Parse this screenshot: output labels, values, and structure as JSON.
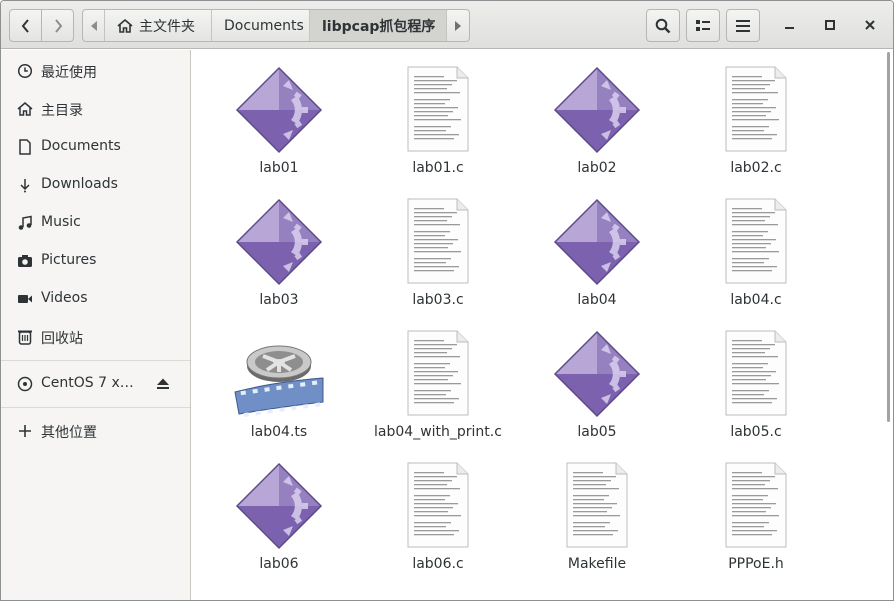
{
  "header": {
    "back_icon": "chevron-left",
    "forward_icon": "chevron-right",
    "path": [
      {
        "label": "主文件夹",
        "icon": "home-icon"
      },
      {
        "label": "Documents"
      },
      {
        "label": "libpcap抓包程序",
        "active": true
      }
    ],
    "search_icon": "search",
    "view_icon": "list-view",
    "menu_icon": "hamburger-menu",
    "window_controls": [
      "minimize",
      "maximize",
      "close"
    ]
  },
  "sidebar": {
    "items": [
      {
        "label": "最近使用",
        "icon": "clock-icon"
      },
      {
        "label": "主目录",
        "icon": "home-icon"
      },
      {
        "label": "Documents",
        "icon": "document-icon"
      },
      {
        "label": "Downloads",
        "icon": "download-icon"
      },
      {
        "label": "Music",
        "icon": "music-icon"
      },
      {
        "label": "Pictures",
        "icon": "camera-icon"
      },
      {
        "label": "Videos",
        "icon": "video-icon"
      },
      {
        "label": "回收站",
        "icon": "trash-icon"
      }
    ],
    "devices": [
      {
        "label": "CentOS 7 x…",
        "icon": "disc-icon",
        "action_icon": "eject-icon"
      }
    ],
    "other": {
      "label": "其他位置",
      "icon": "plus-icon"
    }
  },
  "files": [
    {
      "name": "lab01",
      "type": "executable"
    },
    {
      "name": "lab01.c",
      "type": "text"
    },
    {
      "name": "lab02",
      "type": "executable"
    },
    {
      "name": "lab02.c",
      "type": "text"
    },
    {
      "name": "lab03",
      "type": "executable"
    },
    {
      "name": "lab03.c",
      "type": "text"
    },
    {
      "name": "lab04",
      "type": "executable"
    },
    {
      "name": "lab04.c",
      "type": "text"
    },
    {
      "name": "lab04.ts",
      "type": "video"
    },
    {
      "name": "lab04_with_print.c",
      "type": "text"
    },
    {
      "name": "lab05",
      "type": "executable"
    },
    {
      "name": "lab05.c",
      "type": "text"
    },
    {
      "name": "lab06",
      "type": "executable"
    },
    {
      "name": "lab06.c",
      "type": "text"
    },
    {
      "name": "Makefile",
      "type": "text"
    },
    {
      "name": "PPPoE.h",
      "type": "text"
    }
  ],
  "colors": {
    "exec_light": "#b7a6d6",
    "exec_dark": "#7c62ae",
    "exec_gear": "#d9cfee",
    "accent": "#4a90d9"
  }
}
